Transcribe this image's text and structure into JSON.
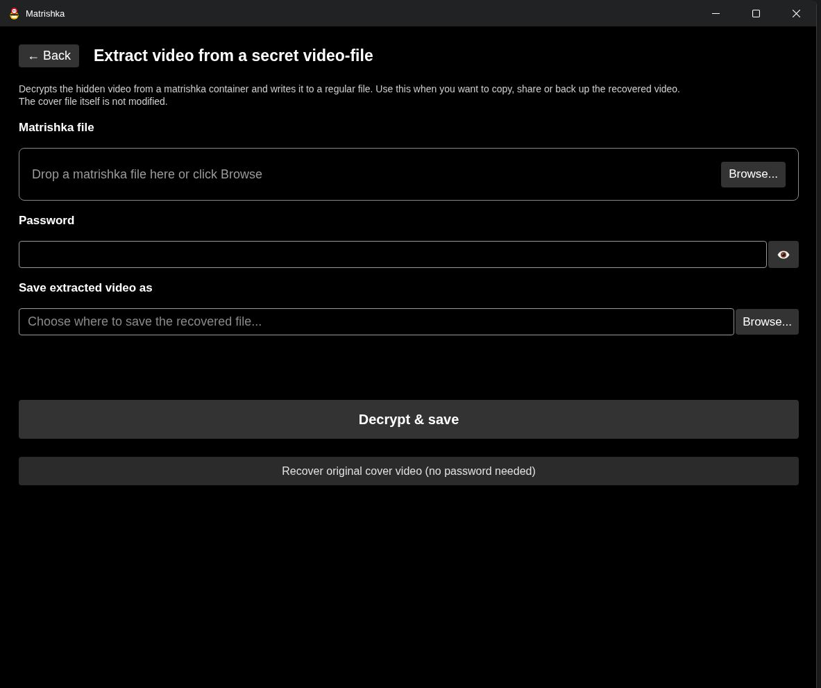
{
  "window": {
    "title": "Matrishka",
    "controls": [
      {
        "kind": "minimize"
      },
      {
        "kind": "maximize"
      },
      {
        "kind": "close"
      }
    ]
  },
  "header": {
    "back_button": "← Back",
    "title": "Extract video from a secret video-file"
  },
  "description": "Decrypts the hidden video from a matrishka container and writes it to a regular file. Use this when you want to copy, share or back up the recovered video.\nThe cover file itself is not modified.",
  "fields": [
    {
      "kind": "dropzone",
      "label": "Matrishka file",
      "placeholder": "Drop a matrishka file here or click Browse",
      "button": "Browse..."
    },
    {
      "kind": "password",
      "label": "Password"
    },
    {
      "kind": "file",
      "label": "Save extracted video as",
      "placeholder": "Choose where to save the recovered file...",
      "button": "Browse..."
    }
  ],
  "actions": [
    {
      "label": "Decrypt & save",
      "primary": true
    },
    {
      "label": "Recover original cover video (no password needed)",
      "primary": false
    }
  ]
}
